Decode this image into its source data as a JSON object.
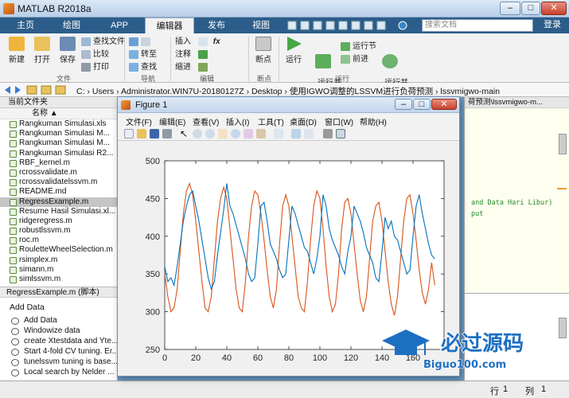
{
  "app": {
    "title": "MATLAB R2018a"
  },
  "window_controls": {
    "minimize": "–",
    "maximize": "□",
    "close": "✕"
  },
  "tabs": [
    {
      "label": "主页"
    },
    {
      "label": "绘图"
    },
    {
      "label": "APP"
    },
    {
      "label": "编辑器"
    },
    {
      "label": "发布"
    },
    {
      "label": "视图"
    }
  ],
  "search": {
    "placeholder": "搜索文档"
  },
  "login": "登录",
  "ribbon": {
    "new": "新建",
    "open": "打开",
    "save": "保存",
    "find_files": "查找文件",
    "compare": "比较",
    "print": "打印",
    "goto": "转至",
    "find": "查找",
    "insert": "插入",
    "comment": "注释",
    "indent": "缩进",
    "breakpoints": "断点",
    "run": "运行",
    "run_advance": "运行并\n前进",
    "run_section": "运行节",
    "advance": "前进",
    "run_time": "运行并\n计时",
    "groups": {
      "file": "文件",
      "navigate": "导航",
      "edit": "编辑",
      "breakpoints": "断点",
      "run": "运行"
    }
  },
  "address": {
    "path": "C: › Users › Administrator.WIN7U-20180127Z › Desktop › 使用IGWO调整的LSSVM进行负荷预测 › lssvmigwo-main"
  },
  "folder_panel": {
    "title": "当前文件夹",
    "column": "名称 ▲",
    "files": [
      "Rangkuman Simulasi.xls",
      "Rangkuman Simulasi M...",
      "Rangkuman Simulasi M...",
      "Rangkuman Simulasi R2...",
      "RBF_kernel.m",
      "rcrossvalidate.m",
      "rcrossvalidatelssvm.m",
      "README.md",
      "RegressExample.m",
      "Resume Hasil Simulasi.xl...",
      "ridgeregress.m",
      "robustlssvm.m",
      "roc.m",
      "RouletteWheelSelection.m",
      "rsimplex.m",
      "simann.m",
      "simlssvm.m"
    ],
    "selected_index": 8
  },
  "details": {
    "header": "RegressExample.m  (脚本)",
    "title": "Add Data",
    "items": [
      "Add Data",
      "Windowize data",
      "create Xtestdata and Yte...",
      "Start 4-fold CV tuning. Er...",
      "tunelssvm tuning is base...",
      "Local search by Nelder ..."
    ]
  },
  "editor": {
    "tab": "荷预测\\lssvmigwo-m...",
    "code_line1": "and Data Hari Libur)",
    "code_line2": "put"
  },
  "status": {
    "row_label": "行",
    "row": "1",
    "col_label": "列",
    "col": "1"
  },
  "figure": {
    "title": "Figure 1",
    "menus": [
      "文件(F)",
      "编辑(E)",
      "查看(V)",
      "插入(I)",
      "工具(T)",
      "桌面(D)",
      "窗口(W)",
      "帮助(H)"
    ]
  },
  "watermark": {
    "text": "必过源码",
    "url": "Biguo100.com"
  },
  "chart_data": {
    "type": "line",
    "xlim": [
      0,
      180
    ],
    "ylim": [
      250,
      500
    ],
    "xticks": [
      0,
      20,
      40,
      60,
      80,
      100,
      120,
      140,
      160
    ],
    "yticks": [
      250,
      300,
      350,
      400,
      450,
      500
    ],
    "grid": false,
    "series": [
      {
        "color": "#0072bd",
        "x": [
          0,
          2,
          4,
          6,
          8,
          10,
          12,
          14,
          16,
          18,
          20,
          22,
          24,
          26,
          28,
          30,
          32,
          34,
          36,
          38,
          40,
          42,
          44,
          46,
          48,
          50,
          52,
          54,
          56,
          58,
          60,
          62,
          64,
          66,
          68,
          70,
          72,
          74,
          76,
          78,
          80,
          82,
          84,
          86,
          88,
          90,
          92,
          94,
          96,
          98,
          100,
          102,
          104,
          106,
          108,
          110,
          112,
          114,
          116,
          118,
          120,
          122,
          124,
          126,
          128,
          130,
          132,
          134,
          136,
          138,
          140,
          142,
          144,
          146,
          148,
          150,
          152,
          154,
          156,
          158,
          160,
          162,
          164,
          166,
          168,
          170,
          172,
          174
        ],
        "y": [
          360,
          340,
          345,
          335,
          360,
          390,
          420,
          440,
          455,
          460,
          440,
          420,
          395,
          370,
          345,
          330,
          340,
          375,
          405,
          435,
          470,
          440,
          430,
          415,
          400,
          385,
          370,
          350,
          340,
          345,
          390,
          440,
          445,
          420,
          390,
          380,
          370,
          355,
          345,
          350,
          395,
          440,
          430,
          415,
          400,
          385,
          380,
          365,
          350,
          370,
          400,
          455,
          440,
          410,
          395,
          385,
          375,
          360,
          350,
          380,
          400,
          440,
          430,
          420,
          405,
          385,
          375,
          365,
          345,
          340,
          380,
          425,
          410,
          420,
          400,
          395,
          380,
          365,
          350,
          355,
          400,
          440,
          455,
          430,
          410,
          390,
          375,
          370
        ]
      },
      {
        "color": "#d95319",
        "x": [
          0,
          2,
          4,
          6,
          8,
          10,
          12,
          14,
          16,
          18,
          20,
          22,
          24,
          26,
          28,
          30,
          32,
          34,
          36,
          38,
          40,
          42,
          44,
          46,
          48,
          50,
          52,
          54,
          56,
          58,
          60,
          62,
          64,
          66,
          68,
          70,
          72,
          74,
          76,
          78,
          80,
          82,
          84,
          86,
          88,
          90,
          92,
          94,
          96,
          98,
          100,
          102,
          104,
          106,
          108,
          110,
          112,
          114,
          116,
          118,
          120,
          122,
          124,
          126,
          128,
          130,
          132,
          134,
          136,
          138,
          140,
          142,
          144,
          146,
          148,
          150,
          152,
          154,
          156,
          158,
          160,
          162,
          164,
          166,
          168,
          170,
          172,
          174
        ],
        "y": [
          350,
          320,
          300,
          305,
          330,
          380,
          430,
          460,
          470,
          455,
          420,
          380,
          340,
          305,
          300,
          320,
          370,
          420,
          450,
          465,
          450,
          410,
          370,
          330,
          305,
          300,
          340,
          400,
          440,
          460,
          455,
          430,
          395,
          355,
          320,
          305,
          330,
          390,
          440,
          455,
          440,
          400,
          360,
          320,
          305,
          300,
          340,
          395,
          440,
          460,
          450,
          410,
          360,
          320,
          300,
          310,
          350,
          410,
          445,
          450,
          430,
          390,
          350,
          315,
          300,
          320,
          370,
          420,
          440,
          445,
          420,
          380,
          340,
          310,
          295,
          320,
          370,
          420,
          450,
          455,
          430,
          395,
          355,
          325,
          310,
          330,
          365,
          335
        ]
      }
    ]
  }
}
